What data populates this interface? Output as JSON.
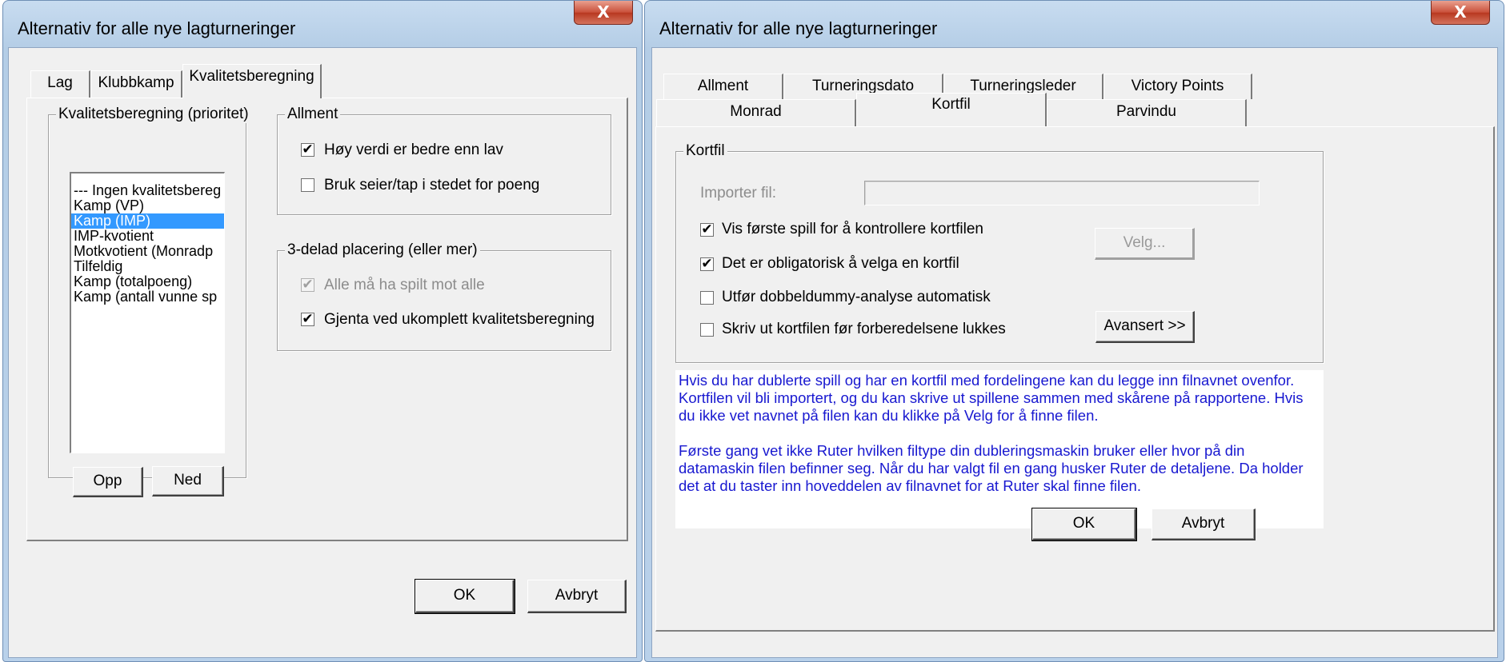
{
  "left_dialog": {
    "title": "Alternativ for alle nye lagturneringer",
    "close_symbol": "X",
    "tabs": [
      "Lag",
      "Klubbkamp",
      "Kvalitetsberegning"
    ],
    "priority_group": {
      "label": "Kvalitetsberegning (prioritet)",
      "items": [
        "--- Ingen kvalitetsbereg",
        "Kamp (VP)",
        "Kamp (IMP)",
        "IMP-kvotient",
        "Motkvotient (Monradp",
        "Tilfeldig",
        "Kamp (totalpoeng)",
        "Kamp (antall vunne sp"
      ],
      "selected_index": 2,
      "up_label": "Opp",
      "down_label": "Ned"
    },
    "general_group": {
      "label": "Allment",
      "options": [
        {
          "label": "Høy verdi er bedre enn lav",
          "checked": true
        },
        {
          "label": "Bruk seier/tap i stedet for poeng",
          "checked": false
        }
      ]
    },
    "tie_group": {
      "label": "3-delad placering (eller mer)",
      "options": [
        {
          "label": "Alle må ha spilt mot alle",
          "checked": true,
          "disabled": true
        },
        {
          "label": "Gjenta ved ukomplett kvalitetsberegning",
          "checked": true
        }
      ]
    },
    "ok_label": "OK",
    "cancel_label": "Avbryt"
  },
  "right_dialog": {
    "title": "Alternativ for alle nye lagturneringer",
    "close_symbol": "X",
    "tabs_row1": [
      "Allment",
      "Turneringsdato",
      "Turneringsleder",
      "Victory Points"
    ],
    "tabs_row2": [
      "Monrad",
      "Kortfil",
      "Parvindu"
    ],
    "kortfil_group": {
      "label": "Kortfil",
      "import_label": "Importer fil:",
      "import_value": "",
      "choose_label": "Velg...",
      "advanced_label": "Avansert >>",
      "options": [
        {
          "label": "Vis første spill for å kontrollere kortfilen",
          "checked": true
        },
        {
          "label": "Det er obligatorisk å velga en kortfil",
          "checked": true
        },
        {
          "label": "Utfør dobbeldummy-analyse automatisk",
          "checked": false
        },
        {
          "label": "Skriv ut kortfilen før forberedelsene lukkes",
          "checked": false
        }
      ]
    },
    "info_paragraphs": [
      "Hvis du har dublerte spill og har en kortfil med fordelingene kan du legge inn filnavnet ovenfor. Kortfilen vil bli importert, og du kan skrive ut spillene sammen med skårene på rapportene. Hvis du ikke vet navnet på filen kan du klikke på Velg for å finne filen.",
      "Første gang vet ikke Ruter hvilken filtype din dubleringsmaskin bruker eller hvor på din datamaskin filen befinner seg. Når du  har valgt fil en gang husker Ruter de detaljene. Da holder det at du taster inn hoveddelen av filnavnet for at Ruter skal finne filen."
    ],
    "ok_label": "OK",
    "cancel_label": "Avbryt"
  },
  "colors": {
    "selection": "#3399ff",
    "info_text": "#1818d0",
    "close_button": "#c9503a"
  }
}
